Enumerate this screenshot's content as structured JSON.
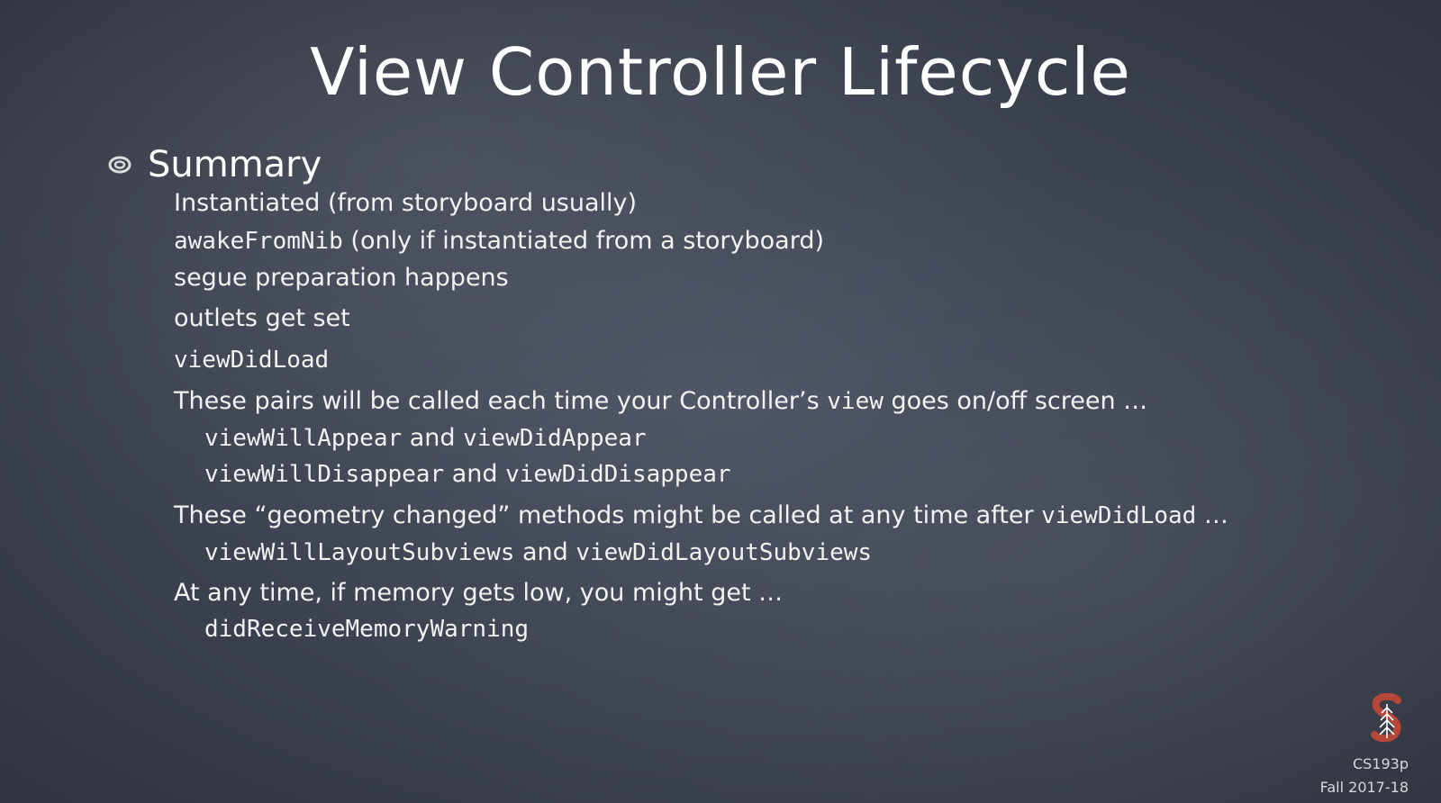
{
  "title": "View Controller Lifecycle",
  "summary_heading": "Summary",
  "lines": {
    "l1": "Instantiated (from storyboard usually)",
    "l2_code": "awakeFromNib",
    "l2_text": " (only if instantiated from a storyboard)",
    "l3": "segue preparation happens",
    "l4": "outlets get set",
    "l5_code": "viewDidLoad",
    "l6_a": "These pairs will be called each time your Controller’s ",
    "l6_code": "view",
    "l6_b": " goes on/off screen …",
    "l7_code_a": "viewWillAppear",
    "l7_and": " and ",
    "l7_code_b": "viewDidAppear",
    "l8_code_a": "viewWillDisappear",
    "l8_and": " and ",
    "l8_code_b": "viewDidDisappear",
    "l9_a": "These “geometry changed” methods might be called at any time after ",
    "l9_code": "viewDidLoad",
    "l9_b": " …",
    "l10_code_a": "viewWillLayoutSubviews",
    "l10_and": " and ",
    "l10_code_b": "viewDidLayoutSubviews",
    "l11": "At any time, if memory gets low, you might get …",
    "l12_code": "didReceiveMemoryWarning"
  },
  "footer": {
    "course": "CS193p",
    "term": "Fall 2017-18",
    "logo_icon": "stanford-tree-logo-icon"
  },
  "colors": {
    "background": "#3d4250",
    "text": "#f2f2f2",
    "logo": "#b5473a"
  }
}
